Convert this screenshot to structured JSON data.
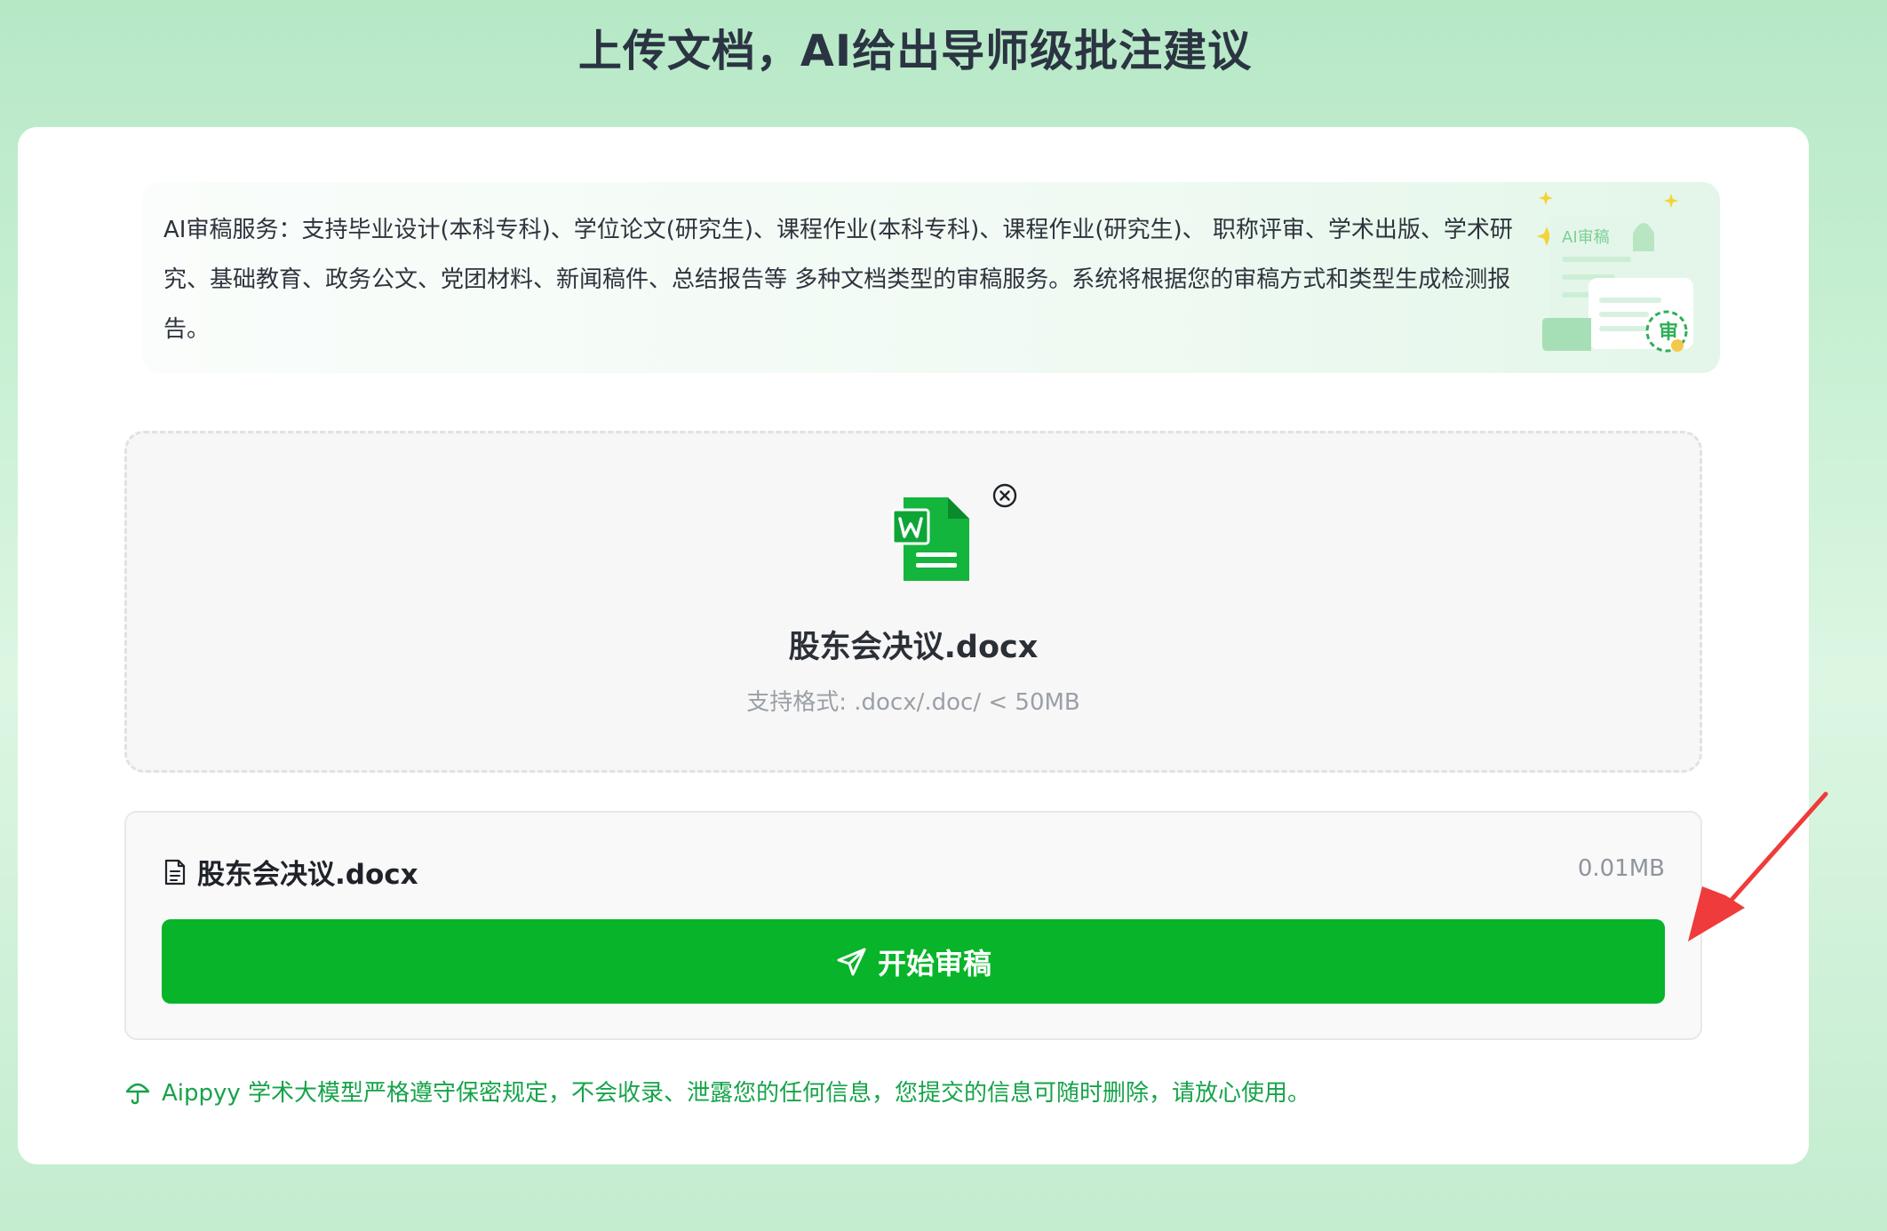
{
  "page": {
    "title": "上传文档，AI给出导师级批注建议"
  },
  "intro": {
    "text": "AI审稿服务：支持毕业设计(本科专科)、学位论文(研究生)、课程作业(本科专科)、课程作业(研究生)、 职称评审、学术出版、学术研究、基础教育、政务公文、党团材料、新闻稿件、总结报告等 多种文档类型的审稿服务。系统将根据您的审稿方式和类型生成检测报告。",
    "illustration_label": "AI审稿",
    "illustration_stamp": "审"
  },
  "upload": {
    "file_name": "股东会决议.docx",
    "format_hint": "支持格式: .docx/.doc/ < 50MB",
    "file_icon": "word-file-icon",
    "remove_icon": "close-circle-icon"
  },
  "file_list": {
    "items": [
      {
        "name": "股东会决议.docx",
        "size": "0.01MB",
        "icon": "document-icon"
      }
    ]
  },
  "actions": {
    "start_review_label": "开始审稿",
    "start_review_icon": "send-icon"
  },
  "footer": {
    "privacy_note": "Aippyy 学术大模型严格遵守保密规定，不会收录、泄露您的任何信息，您提交的信息可随时删除，请放心使用。",
    "privacy_icon": "umbrella-icon"
  },
  "colors": {
    "brand_green": "#07b42a",
    "note_green": "#16a34a",
    "annotation_red": "#ef3b3b"
  }
}
